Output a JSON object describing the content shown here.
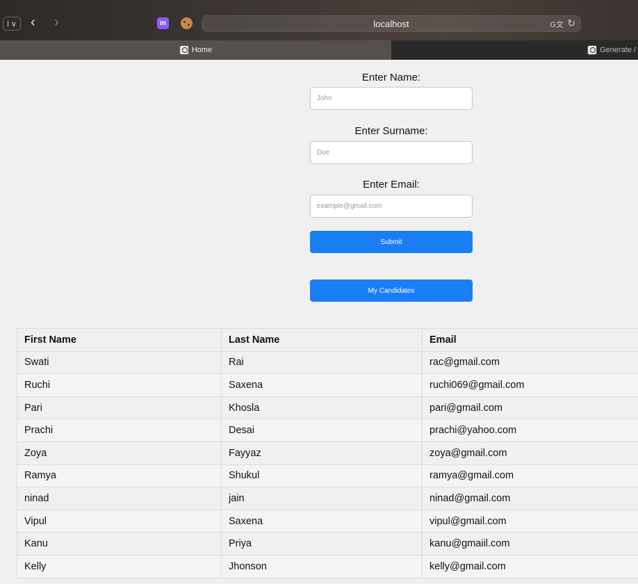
{
  "browser": {
    "url": "localhost",
    "sidebar_toggle_glyph": "l ∨",
    "ext_purple_glyph": "m",
    "translate_glyph": "G文",
    "reload_glyph": "↻",
    "back_glyph": "‹",
    "forward_glyph": "›"
  },
  "tabs": [
    {
      "label": "Home",
      "active": true
    },
    {
      "label": "Generate /",
      "active": false
    }
  ],
  "form": {
    "name_label": "Enter Name:",
    "name_placeholder": "John",
    "surname_label": "Enter Surname:",
    "surname_placeholder": "Doe",
    "email_label": "Enter Email:",
    "email_placeholder": "example@gmail.com",
    "submit_label": "Submit",
    "candidates_label": "My Candidates"
  },
  "table": {
    "headers": [
      "First Name",
      "Last Name",
      "Email"
    ],
    "rows": [
      [
        "Swati",
        "Rai",
        "rac@gmail.com"
      ],
      [
        "Ruchi",
        "Saxena",
        "ruchi069@gmail.com"
      ],
      [
        "Pari",
        "Khosla",
        "pari@gmail.com"
      ],
      [
        "Prachi",
        "Desai",
        "prachi@yahoo.com"
      ],
      [
        "Zoya",
        "Fayyaz",
        "zoya@gmail.com"
      ],
      [
        "Ramya",
        "Shukul",
        "ramya@gmail.com"
      ],
      [
        "ninad",
        "jain",
        "ninad@gmail.com"
      ],
      [
        "Vipul",
        "Saxena",
        "vipul@gmail.com"
      ],
      [
        "Kanu",
        "Priya",
        "kanu@gmaiil.com"
      ],
      [
        "Kelly",
        "Jhonson",
        "kelly@gmail.com"
      ]
    ]
  },
  "colors": {
    "primary_button": "#1a7ef5",
    "page_background": "#f0f0f0"
  }
}
